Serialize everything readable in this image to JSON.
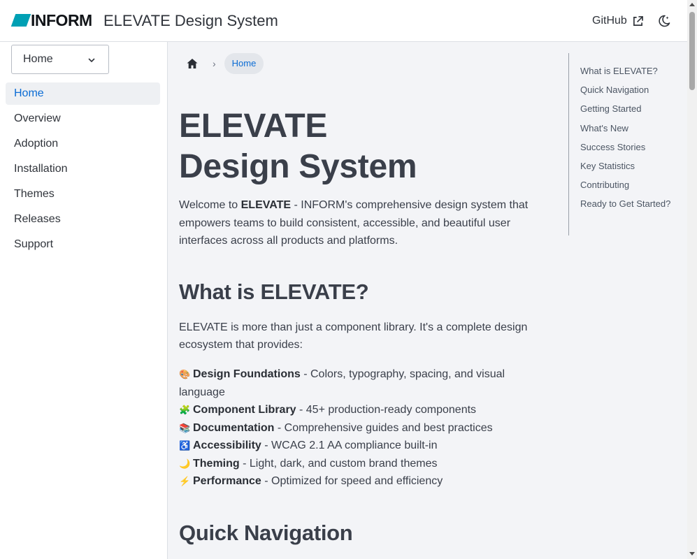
{
  "header": {
    "logo_text": "INFORM",
    "site_title": "ELEVATE Design System",
    "github_label": "GitHub"
  },
  "sidebar": {
    "select_value": "Home",
    "items": [
      {
        "label": "Home",
        "active": true
      },
      {
        "label": "Overview"
      },
      {
        "label": "Adoption"
      },
      {
        "label": "Installation"
      },
      {
        "label": "Themes"
      },
      {
        "label": "Releases"
      },
      {
        "label": "Support"
      }
    ]
  },
  "breadcrumb": {
    "current": "Home"
  },
  "main": {
    "title_line1": "ELEVATE",
    "title_line2": "Design System",
    "intro_pre": "Welcome to ",
    "intro_bold": "ELEVATE",
    "intro_post": " - INFORM's comprehensive design system that empowers teams to build consistent, accessible, and beautiful user interfaces across all products and platforms.",
    "section1_heading": "What is ELEVATE?",
    "section1_text": "ELEVATE is more than just a component library. It's a complete design ecosystem that provides:",
    "features": [
      {
        "emoji": "🎨",
        "title": "Design Foundations",
        "text": " - Colors, typography, spacing, and visual language"
      },
      {
        "emoji": "🧩",
        "title": "Component Library",
        "text": " - 45+ production-ready components"
      },
      {
        "emoji": "📚",
        "title": "Documentation",
        "text": " - Comprehensive guides and best practices"
      },
      {
        "emoji": "♿",
        "title": "Accessibility",
        "text": " - WCAG 2.1 AA compliance built-in"
      },
      {
        "emoji": "🌙",
        "title": "Theming",
        "text": " - Light, dark, and custom brand themes"
      },
      {
        "emoji": "⚡",
        "title": "Performance",
        "text": " - Optimized for speed and efficiency"
      }
    ],
    "section2_heading": "Quick Navigation"
  },
  "toc": {
    "items": [
      "What is ELEVATE?",
      "Quick Navigation",
      "Getting Started",
      "What's New",
      "Success Stories",
      "Key Statistics",
      "Contributing",
      "Ready to Get Started?"
    ]
  },
  "colors": {
    "accent": "#0b6cd4",
    "logo_mark": "#00a0b4",
    "background": "#f3f4f7"
  }
}
